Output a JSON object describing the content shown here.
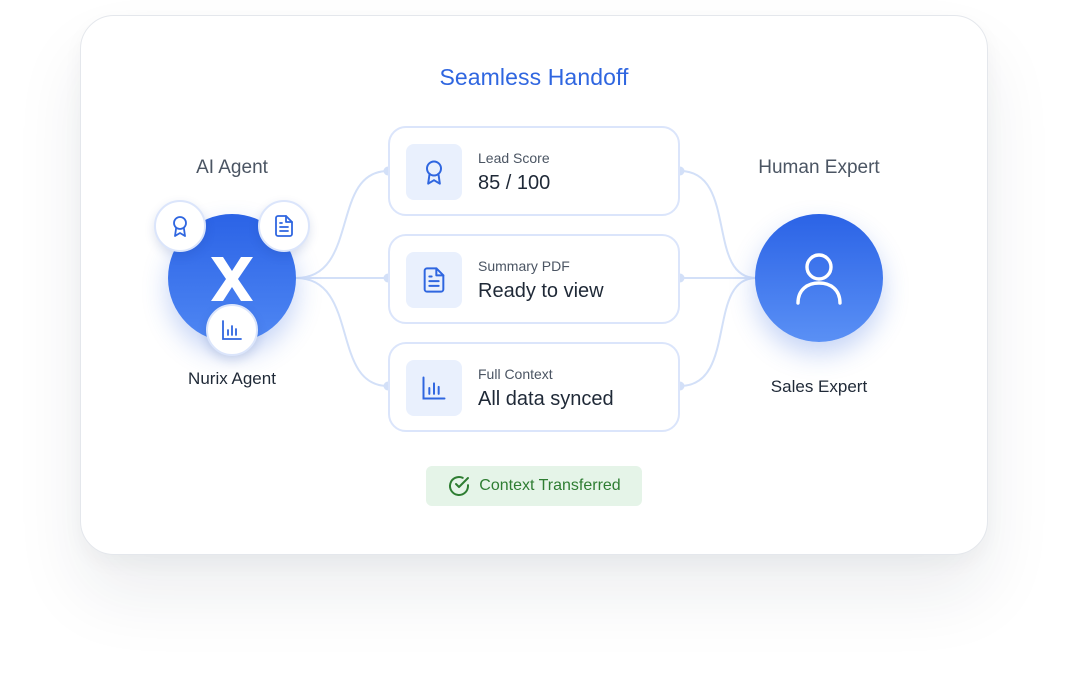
{
  "title": "Seamless Handoff",
  "ai_agent": {
    "heading": "AI Agent",
    "name": "Nurix Agent",
    "logo_icon": "x-logo-icon",
    "badges": [
      "award-icon",
      "document-icon",
      "bar-chart-icon"
    ]
  },
  "human_expert": {
    "heading": "Human Expert",
    "name": "Sales Expert",
    "icon": "user-icon"
  },
  "items": [
    {
      "label": "Lead Score",
      "value": "85 / 100",
      "icon": "award-icon"
    },
    {
      "label": "Summary PDF",
      "value": "Ready to view",
      "icon": "document-icon"
    },
    {
      "label": "Full Context",
      "value": "All data synced",
      "icon": "bar-chart-icon"
    }
  ],
  "status": {
    "text": "Context Transferred",
    "icon": "check-circle-icon"
  },
  "colors": {
    "accent": "#2f66e0",
    "circle_gradient_top": "#2b63e6",
    "circle_gradient_bottom": "#4f87f3",
    "connector": "#d3e0f8",
    "icon_bg": "#e9f0fd",
    "status_bg": "#e5f4e8",
    "status_text": "#2e7d32"
  }
}
